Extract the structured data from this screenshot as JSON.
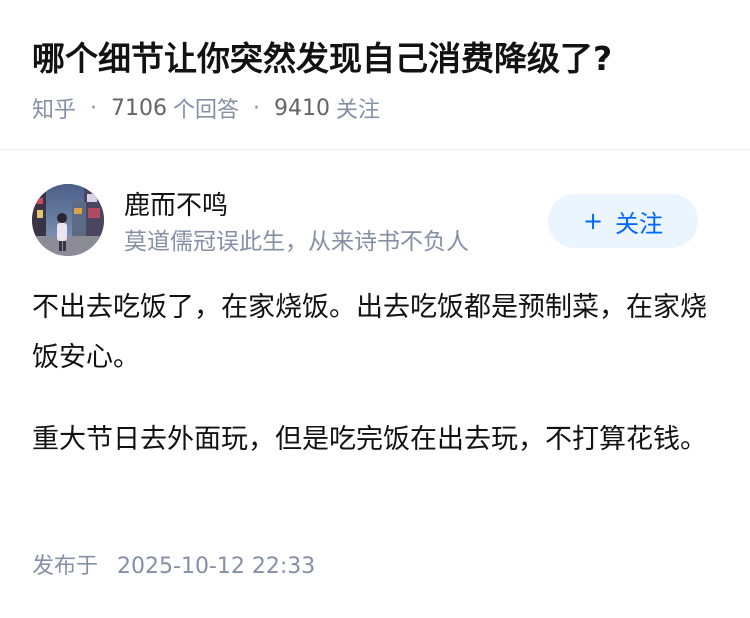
{
  "question": {
    "title": "哪个细节让你突然发现自己消费降级了?",
    "source": "知乎",
    "answer_count": "7106",
    "answer_label": "个回答",
    "follow_count": "9410",
    "follow_label": "关注",
    "separator": "·"
  },
  "author": {
    "name": "鹿而不鸣",
    "bio": "莫道儒冠误此生，从来诗书不负人",
    "follow_button": "关注",
    "follow_icon": "plus-icon"
  },
  "answer": {
    "paragraphs": [
      "不出去吃饭了，在家烧饭。出去吃饭都是预制菜，在家烧饭安心。",
      "重大节日去外面玩，但是吃完饭在出去玩，不打算花钱。"
    ],
    "publish_label": "发布于",
    "publish_time": "2025-10-12 22:33"
  },
  "colors": {
    "accent": "#0066ff",
    "accent_bg": "#ebf5ff",
    "meta_text": "#8590a6",
    "body_text": "#121212"
  }
}
